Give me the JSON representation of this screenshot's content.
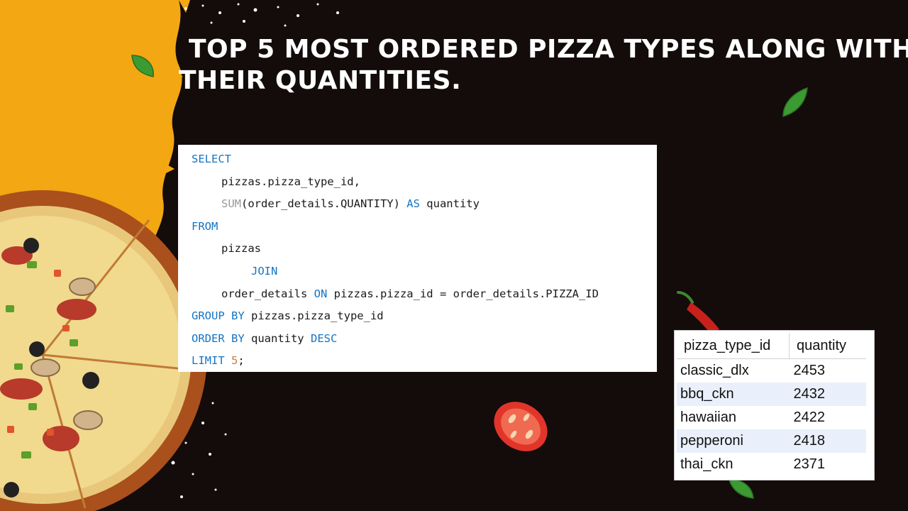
{
  "title": {
    "line1": "Top 5 most ordered pizza types along with",
    "line2": "their quantities."
  },
  "sql": {
    "kw_select": "SELECT",
    "select_col": "pizzas.pizza_type_id,",
    "fn_sum": "SUM",
    "sum_arg": "(order_details.QUANTITY) ",
    "kw_as": "AS",
    "alias": " quantity",
    "kw_from": "FROM",
    "table_pizzas": "pizzas",
    "kw_join": "JOIN",
    "join_table": "order_details ",
    "kw_on": "ON",
    "join_cond": " pizzas.pizza_id = order_details.PIZZA_ID",
    "kw_group_by": "GROUP BY",
    "group_col": " pizzas.pizza_type_id",
    "kw_order_by": "ORDER BY",
    "order_col": " quantity ",
    "kw_desc": "DESC",
    "kw_limit": "LIMIT",
    "limit_space": " ",
    "limit_value": "5",
    "terminator": ";"
  },
  "results": {
    "columns": [
      "pizza_type_id",
      "quantity"
    ],
    "rows": [
      [
        "classic_dlx",
        "2453"
      ],
      [
        "bbq_ckn",
        "2432"
      ],
      [
        "hawaiian",
        "2422"
      ],
      [
        "pepperoni",
        "2418"
      ],
      [
        "thai_ckn",
        "2371"
      ]
    ]
  },
  "colors": {
    "background": "#140b0b",
    "orange_splash": "#f2a713",
    "sql_keyword": "#1574c4",
    "sql_function": "#9a9a9a",
    "sql_number": "#d07a3d",
    "row_highlight": "#e9f0fb"
  },
  "decorations": [
    "pizza-illustration",
    "basil-leaf-icon",
    "chili-pepper-icon",
    "tomato-slice-icon",
    "white-splatter"
  ]
}
